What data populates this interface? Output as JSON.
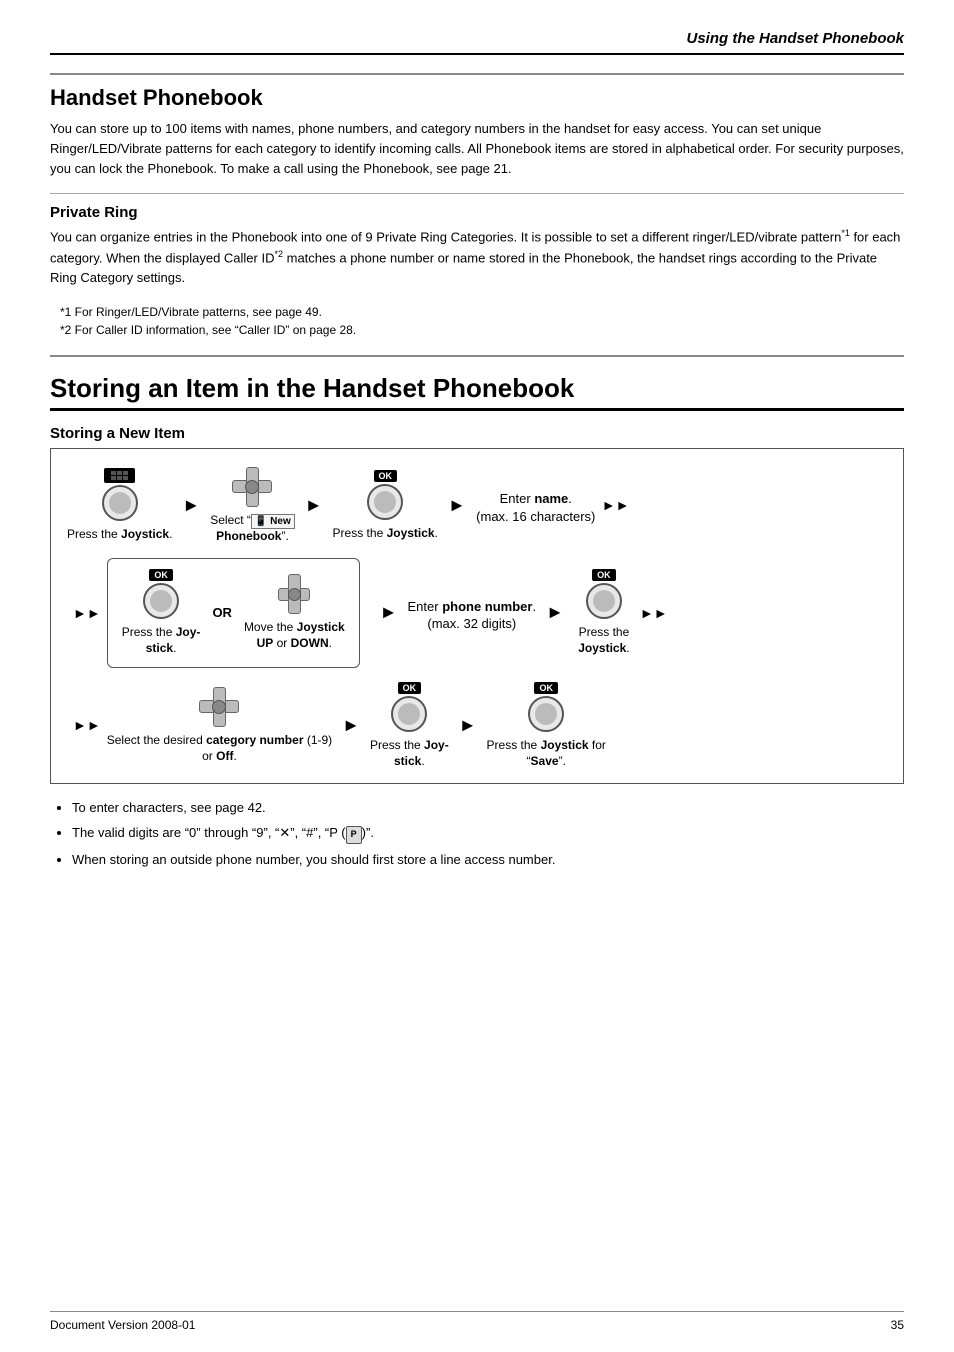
{
  "header": {
    "title": "Using the Handset Phonebook"
  },
  "handset_phonebook": {
    "title": "Handset Phonebook",
    "body": "You can store up to 100 items with names, phone numbers, and category numbers in the handset for easy access. You can set unique Ringer/LED/Vibrate patterns for each category to identify incoming calls. All Phonebook items are stored in alphabetical order. For security purposes, you can lock the Phonebook. To make a call using the Phonebook, see page 21.",
    "private_ring": {
      "title": "Private Ring",
      "body1": "You can organize entries in the Phonebook into one of 9 Private Ring Categories. It is possible to set a different ringer/LED/vibrate pattern",
      "sup1": "*1",
      "body2": " for each category. When the displayed Caller ID",
      "sup2": "*2",
      "body3": " matches a phone number or name stored in the Phonebook, the handset rings according to the Private Ring Category settings.",
      "footnotes": [
        "*1  For Ringer/LED/Vibrate patterns, see page 49.",
        "*2  For Caller ID information, see “Caller ID” on page 28."
      ]
    }
  },
  "storing_section": {
    "title": "Storing an Item in the Handset Phonebook",
    "subtitle": "Storing a New Item",
    "diagram": {
      "step1_label": "Press the Joystick.",
      "step2_label": "Select “📱 New Phonebook”.",
      "step2_icon_text": "New\nPhonebook",
      "step3_label": "Press the Joystick.",
      "step4_label": "Enter name.\n(max. 16 characters)",
      "or_label": "OR",
      "step_or1_label": "Press the Joystick.",
      "step_or2_label": "Move the Joystick UP or DOWN.",
      "step_phone_label": "Enter phone number.\n(max. 32 digits)",
      "step_ok_after_phone_label": "Press the\nJoystick.",
      "step_cat_label": "Select the desired category number (1-9)\nor Off.",
      "step_joy2_label": "Press the Joystick.",
      "step_save_label": "Press the Joystick for “Save”.",
      "ok_label": "OK"
    },
    "bullets": [
      "To enter characters, see page 42.",
      "The valid digits are “0” through “9”, “✕”, “#”, “P (📳)”.",
      "When storing an outside phone number, you should first store a line access number."
    ]
  },
  "footer": {
    "version": "Document Version 2008-01",
    "page": "35"
  }
}
